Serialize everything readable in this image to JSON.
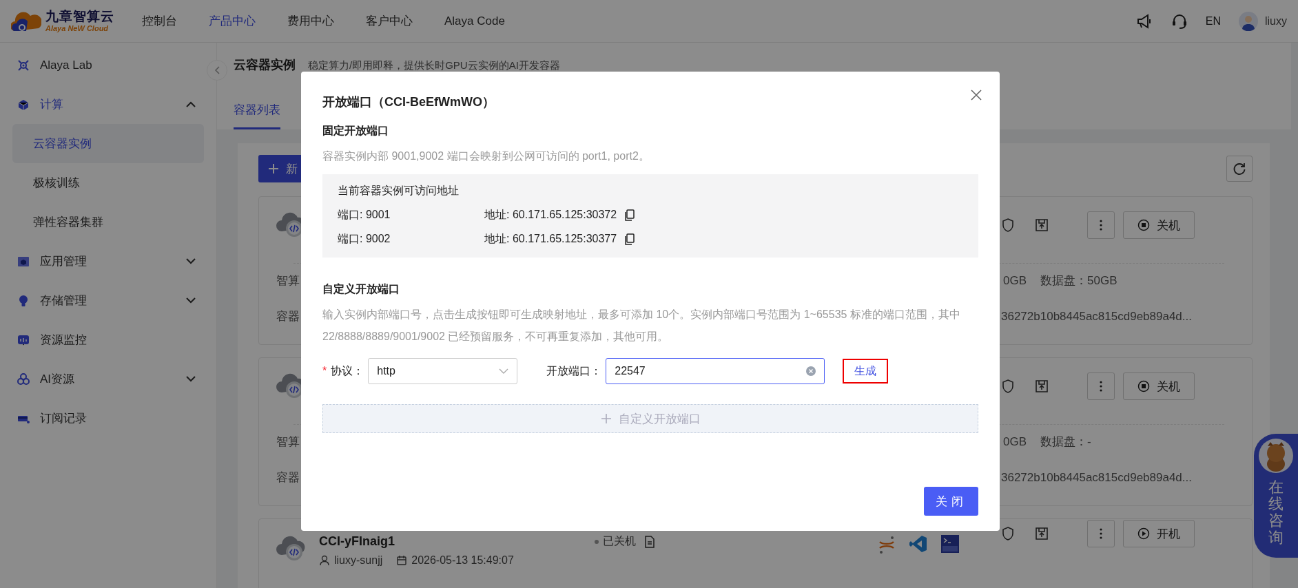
{
  "header": {
    "logo": {
      "name": "九章智算云",
      "tagline": "Alaya NeW Cloud"
    },
    "nav": [
      {
        "label": "控制台",
        "selected": false
      },
      {
        "label": "产品中心",
        "selected": true
      },
      {
        "label": "费用中心",
        "selected": false
      },
      {
        "label": "客户中心",
        "selected": false
      },
      {
        "label": "Alaya Code",
        "selected": false
      }
    ],
    "language": "EN",
    "user": "liuxy"
  },
  "sidebar": {
    "items": [
      {
        "label": "Alaya Lab",
        "selected": false
      },
      {
        "label": "计算",
        "selected": false,
        "expanded": true,
        "children": [
          {
            "label": "云容器实例",
            "selected": true
          },
          {
            "label": "极核训练",
            "selected": false
          },
          {
            "label": "弹性容器集群",
            "selected": false
          }
        ]
      },
      {
        "label": "应用管理",
        "selected": false,
        "expanded": false
      },
      {
        "label": "存储管理",
        "selected": false,
        "expanded": false
      },
      {
        "label": "资源监控",
        "selected": false
      },
      {
        "label": "AI资源",
        "selected": false,
        "expanded": false
      },
      {
        "label": "订阅记录",
        "selected": false
      }
    ]
  },
  "page": {
    "title": "云容器实例",
    "subtitle": "稳定算力/即用即释，提供长时GPU云实例的AI开发容器",
    "tabs": [
      {
        "label": "容器列表",
        "selected": true
      }
    ],
    "create_button": "新",
    "instances": [
      {
        "left_lines": [
          "智算",
          "容器"
        ],
        "spec": [
          "0GB",
          "数据盘：50GB"
        ],
        "id_text": "36272b10b8445ac815cd9eb89a4d...",
        "power_button": {
          "kind": "stop",
          "label": "关机"
        }
      },
      {
        "left_lines": [
          "智算",
          "容器"
        ],
        "spec": [
          "0GB",
          "数据盘：-"
        ],
        "id_text": "36272b10b8445ac815cd9eb89a4d...",
        "power_button": {
          "kind": "stop",
          "label": "关机"
        }
      },
      {
        "name": "CCI-yFInaig1",
        "status": "已关机",
        "user": "liuxy-sunjj",
        "created": "2026-05-13 15:49:07",
        "power_button": {
          "kind": "start",
          "label": "开机"
        }
      }
    ]
  },
  "consult": {
    "label": "在线咨询"
  },
  "dialog": {
    "title": "开放端口（CCI-BeEfWmWO）",
    "fixed_section": {
      "heading": "固定开放端口",
      "description": "容器实例内部 9001,9002 端口会映射到公网可访问的 port1, port2。",
      "box_title": "当前容器实例可访问地址",
      "ports": [
        {
          "port": "端口: 9001",
          "address": "地址: 60.171.65.125:30372"
        },
        {
          "port": "端口: 9002",
          "address": "地址: 60.171.65.125:30377"
        }
      ]
    },
    "custom_section": {
      "heading": "自定义开放端口",
      "description": "输入实例内部端口号，点击生成按钮即可生成映射地址，最多可添加 10个。实例内部端口号范围为 1~65535 标准的端口范围，其中 22/8888/8889/9001/9002 已经预留服务，不可再重复添加，其他可用。",
      "protocol": {
        "required_mark": "*",
        "label": "协议：",
        "value": "http"
      },
      "port": {
        "label": "开放端口：",
        "value": "22547"
      },
      "generate_button": "生成",
      "add_button": "自定义开放端口"
    },
    "close_button": "关闭"
  }
}
